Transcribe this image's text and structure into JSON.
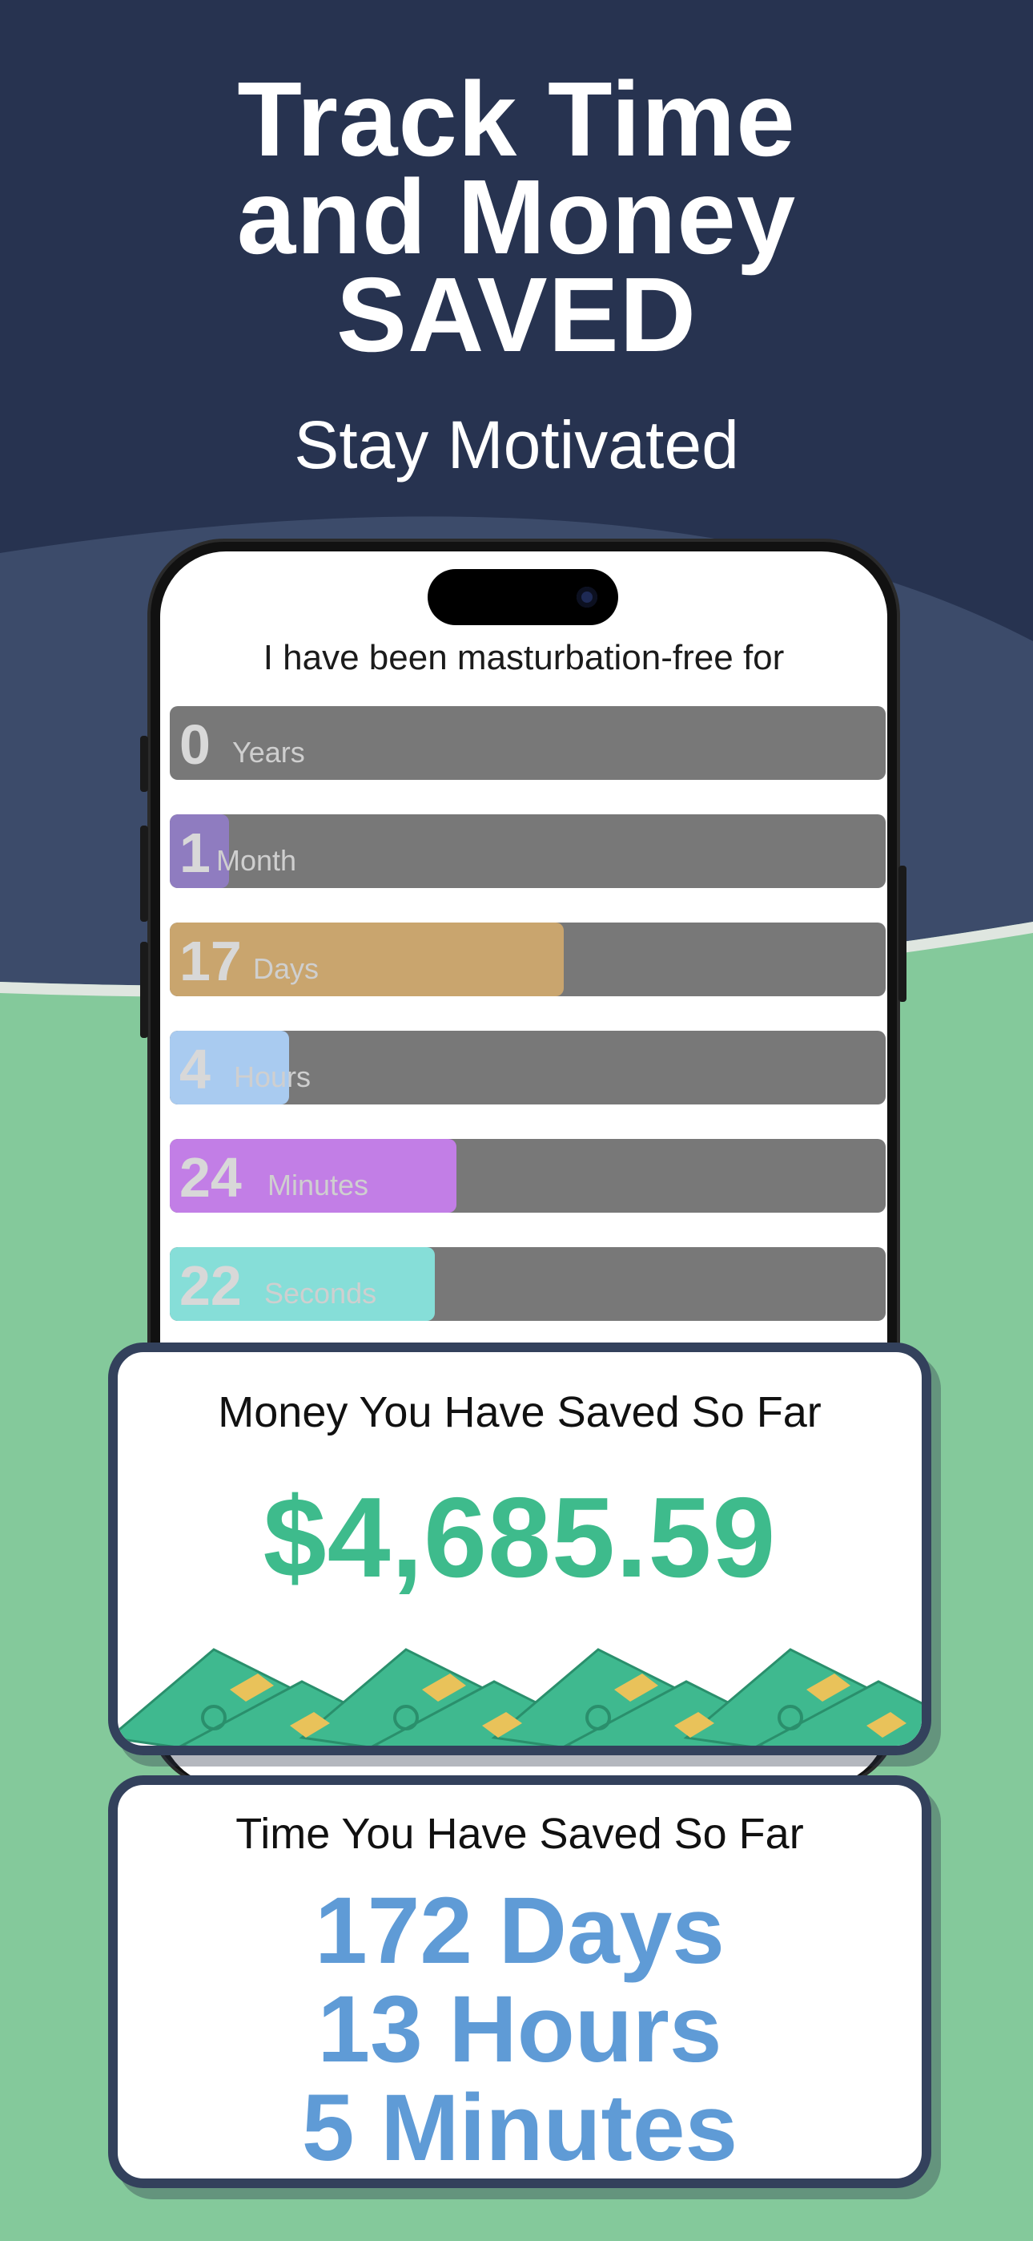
{
  "header": {
    "title_lines": [
      "Track Time",
      "and Money",
      "SAVED"
    ],
    "subtitle": "Stay Motivated"
  },
  "colors": {
    "navy_top": "#273350",
    "navy_band": "#3c4b6a",
    "green_bg": "#84c99b",
    "money_green": "#3ebb8c",
    "time_blue": "#5f9bd6",
    "bar_gray": "#787878"
  },
  "phone": {
    "intro": "I have been masturbation-free for",
    "counters": [
      {
        "value": "0",
        "unit": "Years",
        "progress": 0.0,
        "color": "#787878"
      },
      {
        "value": "1",
        "unit": "Month",
        "progress": 0.083,
        "color": "#8f7cc0"
      },
      {
        "value": "17",
        "unit": "Days",
        "progress": 0.55,
        "color": "#c9a56e"
      },
      {
        "value": "4",
        "unit": "Hours",
        "progress": 0.167,
        "color": "#a9cbf0"
      },
      {
        "value": "24",
        "unit": "Minutes",
        "progress": 0.4,
        "color": "#c27ee6"
      },
      {
        "value": "22",
        "unit": "Seconds",
        "progress": 0.37,
        "color": "#86ded8"
      }
    ]
  },
  "money_card": {
    "title": "Money You Have Saved So Far",
    "amount": "$4,685.59",
    "decoration_icon": "cash-bills-icon"
  },
  "time_card": {
    "title": "Time You Have Saved So Far",
    "lines": [
      "172 Days",
      "13 Hours",
      "5 Minutes"
    ]
  }
}
